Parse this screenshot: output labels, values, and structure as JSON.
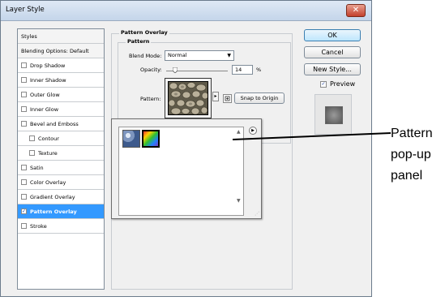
{
  "window": {
    "title": "Layer Style",
    "close_label": "✕"
  },
  "styles_list": {
    "items": [
      {
        "label": "Styles",
        "type": "header"
      },
      {
        "label": "Blending Options: Default",
        "type": "header"
      },
      {
        "label": "Drop Shadow",
        "checked": false
      },
      {
        "label": "Inner Shadow",
        "checked": false
      },
      {
        "label": "Outer Glow",
        "checked": false
      },
      {
        "label": "Inner Glow",
        "checked": false
      },
      {
        "label": "Bevel and Emboss",
        "checked": false
      },
      {
        "label": "Contour",
        "checked": false,
        "sub": true
      },
      {
        "label": "Texture",
        "checked": false,
        "sub": true
      },
      {
        "label": "Satin",
        "checked": false
      },
      {
        "label": "Color Overlay",
        "checked": false
      },
      {
        "label": "Gradient Overlay",
        "checked": false
      },
      {
        "label": "Pattern Overlay",
        "checked": true,
        "selected": true
      },
      {
        "label": "Stroke",
        "checked": false
      }
    ]
  },
  "panel": {
    "group_title": "Pattern Overlay",
    "subgroup_title": "Pattern",
    "blend_mode_label": "Blend Mode:",
    "blend_mode_value": "Normal",
    "opacity_label": "Opacity:",
    "opacity_value": "14",
    "opacity_unit": "%",
    "opacity_level_percent": 14,
    "pattern_label": "Pattern:",
    "snap_button": "Snap to Origin"
  },
  "buttons": {
    "ok": "OK",
    "cancel": "Cancel",
    "new_style": "New Style...",
    "preview": "Preview"
  },
  "preview_checked": true,
  "callout": {
    "text": "Pattern pop-up panel"
  },
  "colors": {
    "selection": "#3399ff",
    "ok_button": "#bee6fd"
  }
}
